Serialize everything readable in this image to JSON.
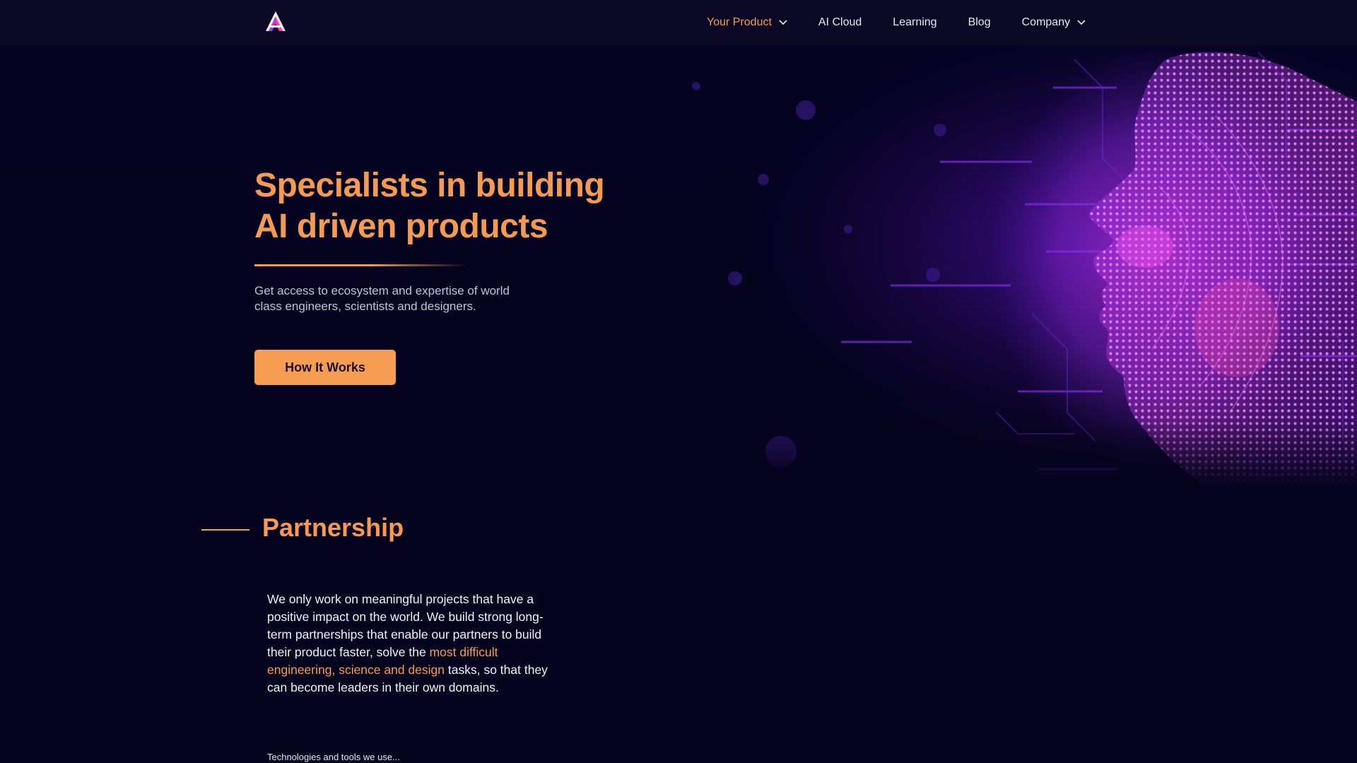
{
  "header": {
    "nav": [
      {
        "label": "Your Product",
        "active": true,
        "dropdown": true
      },
      {
        "label": "AI Cloud",
        "active": false,
        "dropdown": false
      },
      {
        "label": "Learning",
        "active": false,
        "dropdown": false
      },
      {
        "label": "Blog",
        "active": false,
        "dropdown": false
      },
      {
        "label": "Company",
        "active": false,
        "dropdown": true
      }
    ]
  },
  "hero": {
    "title_line1": "Specialists in building",
    "title_line2": "AI driven products",
    "subtitle": "Get access to ecosystem and expertise of world class engineers, scientists and designers.",
    "cta_label": "How It Works"
  },
  "partnership": {
    "title": "Partnership",
    "body_part1": "We only work on meaningful projects that have a positive impact on the world. We build strong long-term partnerships that enable our partners to build their product faster, solve the ",
    "body_highlight": "most difficult engineering, science and design",
    "body_part2": " tasks, so that they can become leaders in their own domains.",
    "tech_note": "Technologies and tools we use..."
  },
  "colors": {
    "accent": "#f59a52",
    "background": "#07041f",
    "header_bg": "#0b0826",
    "cta_bg": "#f79d53",
    "art_purple": "#b23cff",
    "art_magenta": "#e23bd6"
  },
  "icons": {
    "logo": "triangle-a-logo-icon",
    "dropdown": "chevron-down-icon",
    "hero_art": "ai-face-illustration"
  }
}
